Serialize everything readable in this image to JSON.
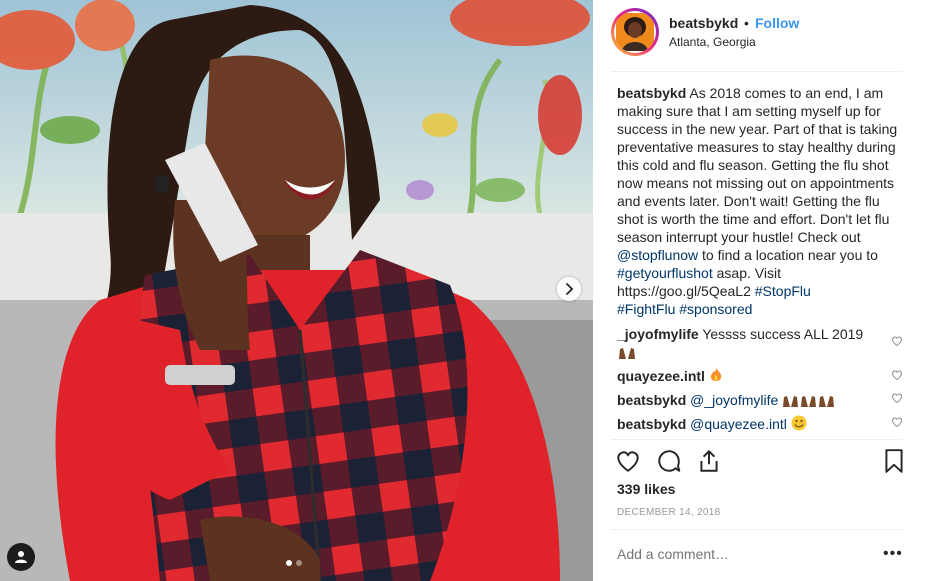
{
  "post": {
    "username": "beatsbykd",
    "separator": "•",
    "follow_label": "Follow",
    "location": "Atlanta, Georgia",
    "photo_index": 1,
    "photo_count": 2
  },
  "caption": {
    "username": "beatsbykd",
    "text_1": " As 2018 comes to an end, I am making sure that I am setting myself up for success in the new year. Part of that is taking preventative measures to stay healthy during this cold and flu season. Getting the flu shot now means not missing out on appointments and events later. Don't wait! Getting the flu shot is worth the time and effort. Don't let flu season interrupt your hustle! Check out ",
    "mention_1": "@stopflunow",
    "text_2": " to find a location near you to ",
    "hashtag_1": "#getyourflushot",
    "text_3": " asap. Visit https://goo.gl/5QeaL2 ",
    "hashtag_2": "#StopFlu",
    "hashtag_3": "#FightFlu",
    "hashtag_4": "#sponsored"
  },
  "comments": [
    {
      "username": "_joyofmylife",
      "text": " Yessss success ALL 2019 ",
      "emoji": "raised-hands"
    },
    {
      "username": "quayezee.intl",
      "text": " ",
      "emoji": "fire"
    },
    {
      "username": "beatsbykd",
      "mention": "@_joyofmylife",
      "emoji": "raised-hands-x3"
    },
    {
      "username": "beatsbykd",
      "mention": "@quayezee.intl",
      "emoji": "smile"
    }
  ],
  "likes_label": "339 likes",
  "date": "DECEMBER 14, 2018",
  "add_comment_placeholder": "Add a comment…",
  "more_label": "•••",
  "colors": {
    "link_blue": "#3897f0",
    "mention_color": "#003569",
    "muted": "#999999",
    "text": "#262626",
    "shirt_red": "#e0232a"
  },
  "icons": [
    "heart-icon",
    "comment-icon",
    "share-icon",
    "bookmark-icon",
    "chevron-right-icon",
    "user-tag-icon",
    "more-icon"
  ]
}
